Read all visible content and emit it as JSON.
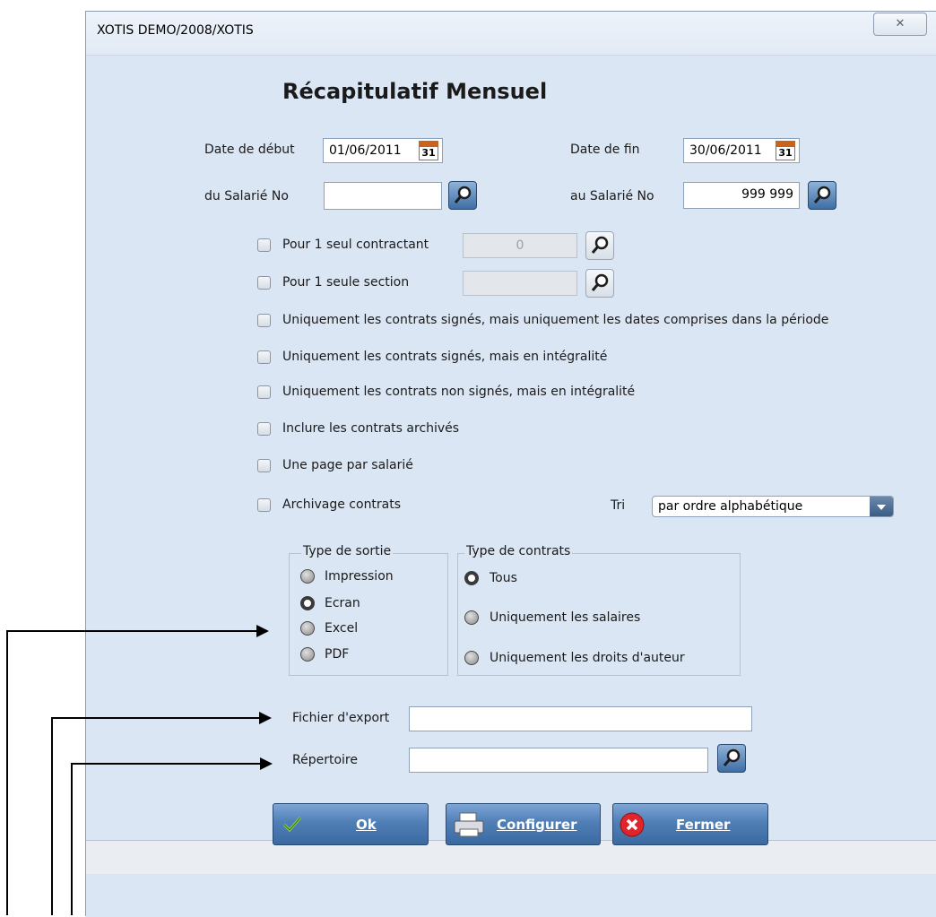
{
  "window": {
    "title": "XOTIS DEMO/2008/XOTIS",
    "close_symbol": "✕"
  },
  "dialog": {
    "title": "Récapitulatif Mensuel"
  },
  "date_debut": {
    "label": "Date de début",
    "value": "01/06/2011"
  },
  "date_fin": {
    "label": "Date de fin",
    "value": "30/06/2011"
  },
  "calendar_day": "31",
  "salarie_from": {
    "label": "du Salarié No",
    "value": ""
  },
  "salarie_to": {
    "label": "au Salarié No",
    "value": "999 999"
  },
  "options": {
    "contractant": {
      "label": "Pour 1 seul contractant",
      "value": "0"
    },
    "section": {
      "label": "Pour 1 seule section",
      "value": ""
    },
    "contrats_signes_dates": "Uniquement les contrats signés, mais uniquement les dates comprises dans la période",
    "contrats_signes_integralite": "Uniquement les contrats signés, mais en intégralité",
    "contrats_non_signes": "Uniquement les contrats non signés, mais en intégralité",
    "archives": "Inclure les contrats archivés",
    "page_par_salarie": "Une page par salarié",
    "archivage": "Archivage contrats"
  },
  "tri": {
    "label": "Tri",
    "value": "par ordre alphabétique"
  },
  "type_sortie": {
    "legend": "Type de sortie",
    "items": [
      "Impression",
      "Ecran",
      "Excel",
      "PDF"
    ],
    "selected": "Ecran"
  },
  "type_contrats": {
    "legend": "Type de contrats",
    "items": [
      "Tous",
      "Uniquement les salaires",
      "Uniquement les droits d'auteur"
    ],
    "selected": "Tous"
  },
  "fichier_export": {
    "label": "Fichier d'export",
    "value": ""
  },
  "repertoire": {
    "label": "Répertoire",
    "value": ""
  },
  "buttons": {
    "ok": "Ok",
    "configurer": "Configurer",
    "fermer": "Fermer"
  }
}
